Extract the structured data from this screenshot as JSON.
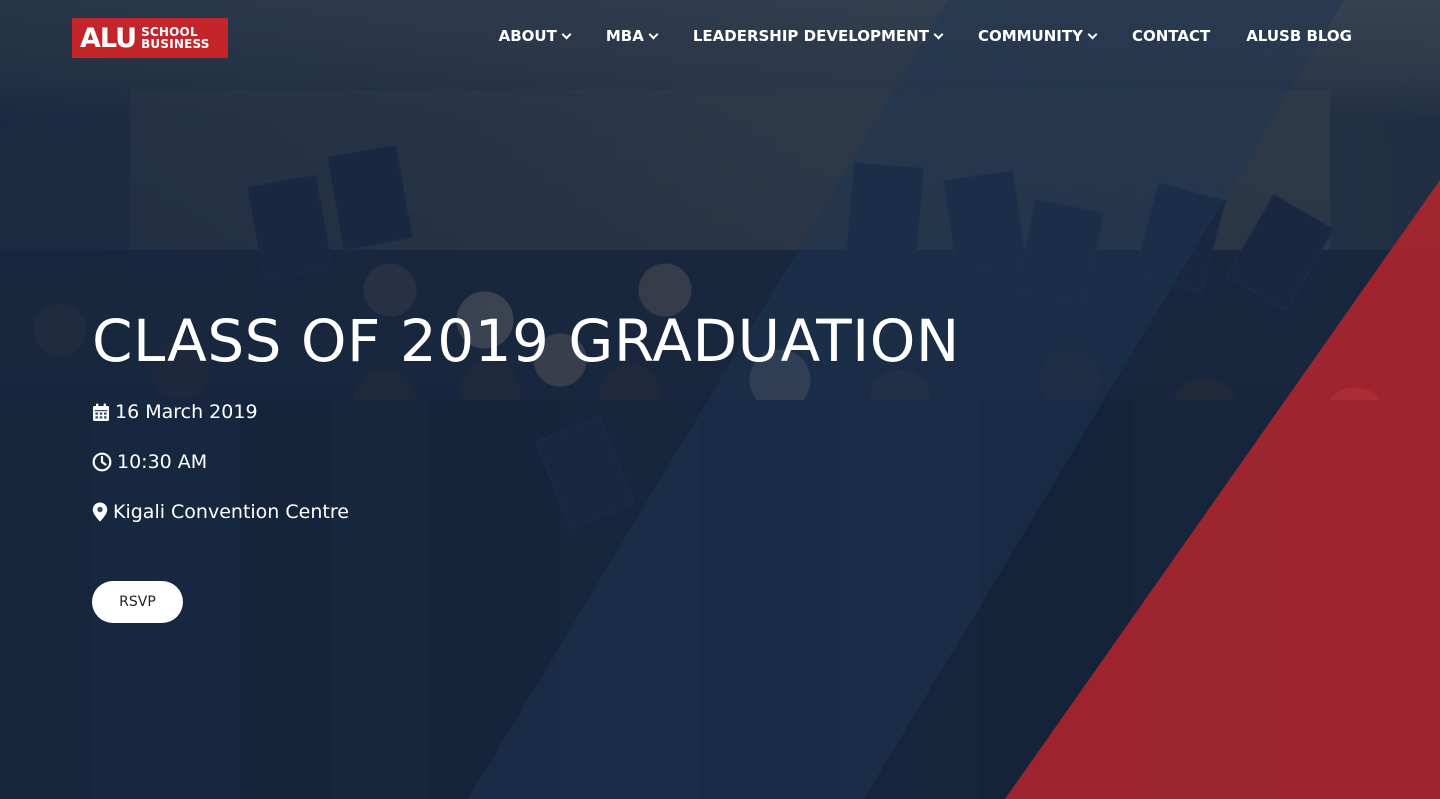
{
  "header": {
    "logo": {
      "mark": "ALU",
      "line1": "SCHOOL",
      "line2": "BUSINESS"
    },
    "nav": [
      {
        "label": "ABOUT",
        "dropdown": true
      },
      {
        "label": "MBA",
        "dropdown": true
      },
      {
        "label": "LEADERSHIP DEVELOPMENT",
        "dropdown": true
      },
      {
        "label": "COMMUNITY",
        "dropdown": true
      },
      {
        "label": "CONTACT",
        "dropdown": false
      },
      {
        "label": "ALUSB BLOG",
        "dropdown": false
      }
    ]
  },
  "event": {
    "title": "CLASS OF 2019 GRADUATION",
    "date": "16 March 2019",
    "time": "10:30 AM",
    "location": "Kigali Convention Centre",
    "rsvp_label": "RSVP"
  },
  "icons": {
    "date": "calendar-icon",
    "time": "clock-icon",
    "location": "map-marker-icon"
  },
  "colors": {
    "brand_red": "#c4252b",
    "overlay_navy": "#182a44",
    "text": "#ffffff"
  }
}
